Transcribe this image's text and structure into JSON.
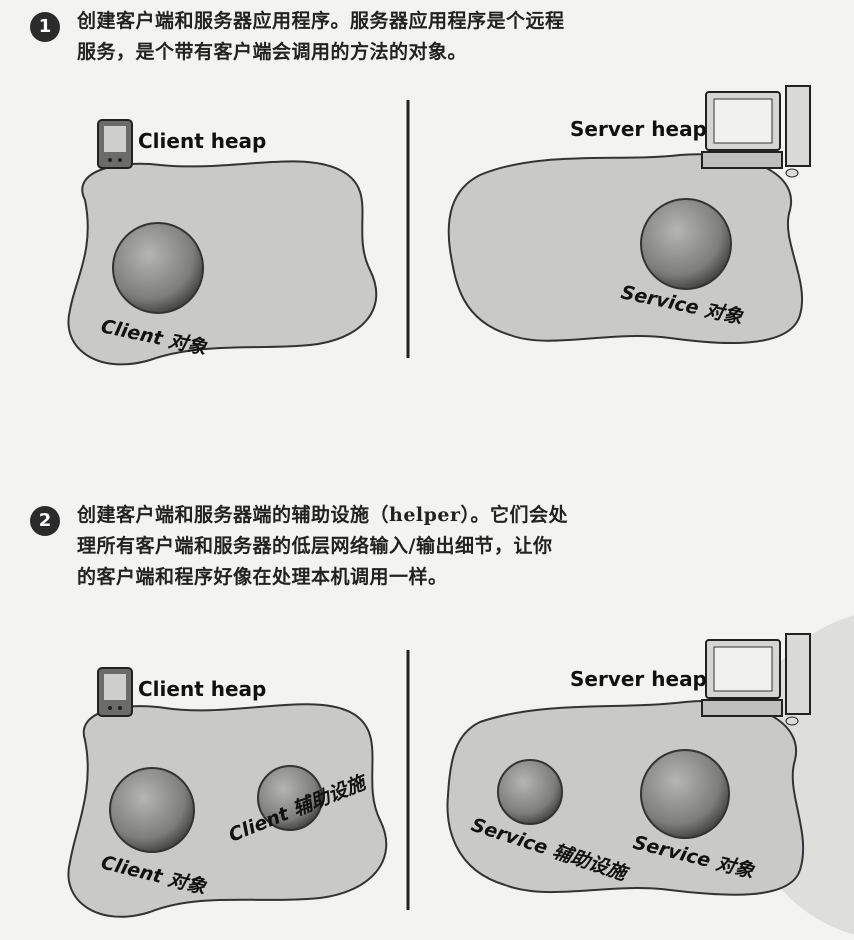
{
  "step1": {
    "number": "1",
    "lines": [
      "创建客户端和服务器应用程序。服务器应用程序是个远程",
      "服务，是个带有客户端会调用的方法的对象。"
    ]
  },
  "step2": {
    "number": "2",
    "lines": [
      "创建客户端和服务器端的辅助设施（helper）。它们会处",
      "理所有客户端和服务器的低层网络输入/输出细节，让你",
      "的客户端和程序好像在处理本机调用一样。"
    ]
  },
  "scene1": {
    "client_heap": "Client heap",
    "server_heap": "Server heap",
    "client_object": "Client 对象",
    "service_object": "Service 对象"
  },
  "scene2": {
    "client_heap": "Client heap",
    "server_heap": "Server heap",
    "client_object": "Client 对象",
    "client_helper": "Client 辅助设施",
    "service_helper": "Service 辅助设施",
    "service_object": "Service 对象"
  },
  "icons": {
    "pda": "pda-device-icon",
    "computer": "desktop-computer-icon"
  },
  "colors": {
    "heap_fill": "#c9c9c7",
    "sphere": "#8a8a88",
    "divider": "#222222"
  }
}
